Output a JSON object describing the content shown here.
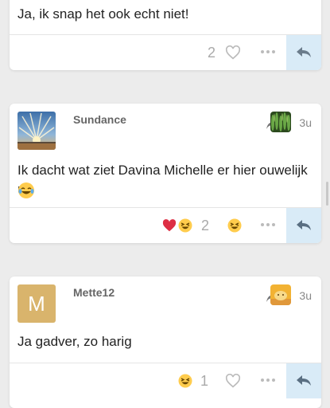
{
  "posts": [
    {
      "text": "Ja, ik snap het ook echt niet!",
      "like_count": "2"
    },
    {
      "username": "Sundance",
      "time": "3u",
      "text_line1": "Ik dacht wat ziet Davina Michelle er hier ouwelijk uit",
      "like_count": "2",
      "avatar_icon": "sunset-landscape-icon",
      "reply_avatar_icon": "green-plants-icon",
      "reactions": [
        "heart-emoji",
        "laughing-emoji"
      ]
    },
    {
      "username": "Mette12",
      "time": "3u",
      "text": "Ja gadver, zo harig",
      "like_count": "1",
      "avatar_letter": "M",
      "avatar_color": "#d9b46c",
      "reply_avatar_icon": "yellow-creature-icon",
      "reactions": [
        "laughing-emoji"
      ]
    }
  ],
  "colors": {
    "accent": "#2f77b3",
    "reply_bg": "#d9ebf7",
    "heart_red": "#e0245e"
  }
}
